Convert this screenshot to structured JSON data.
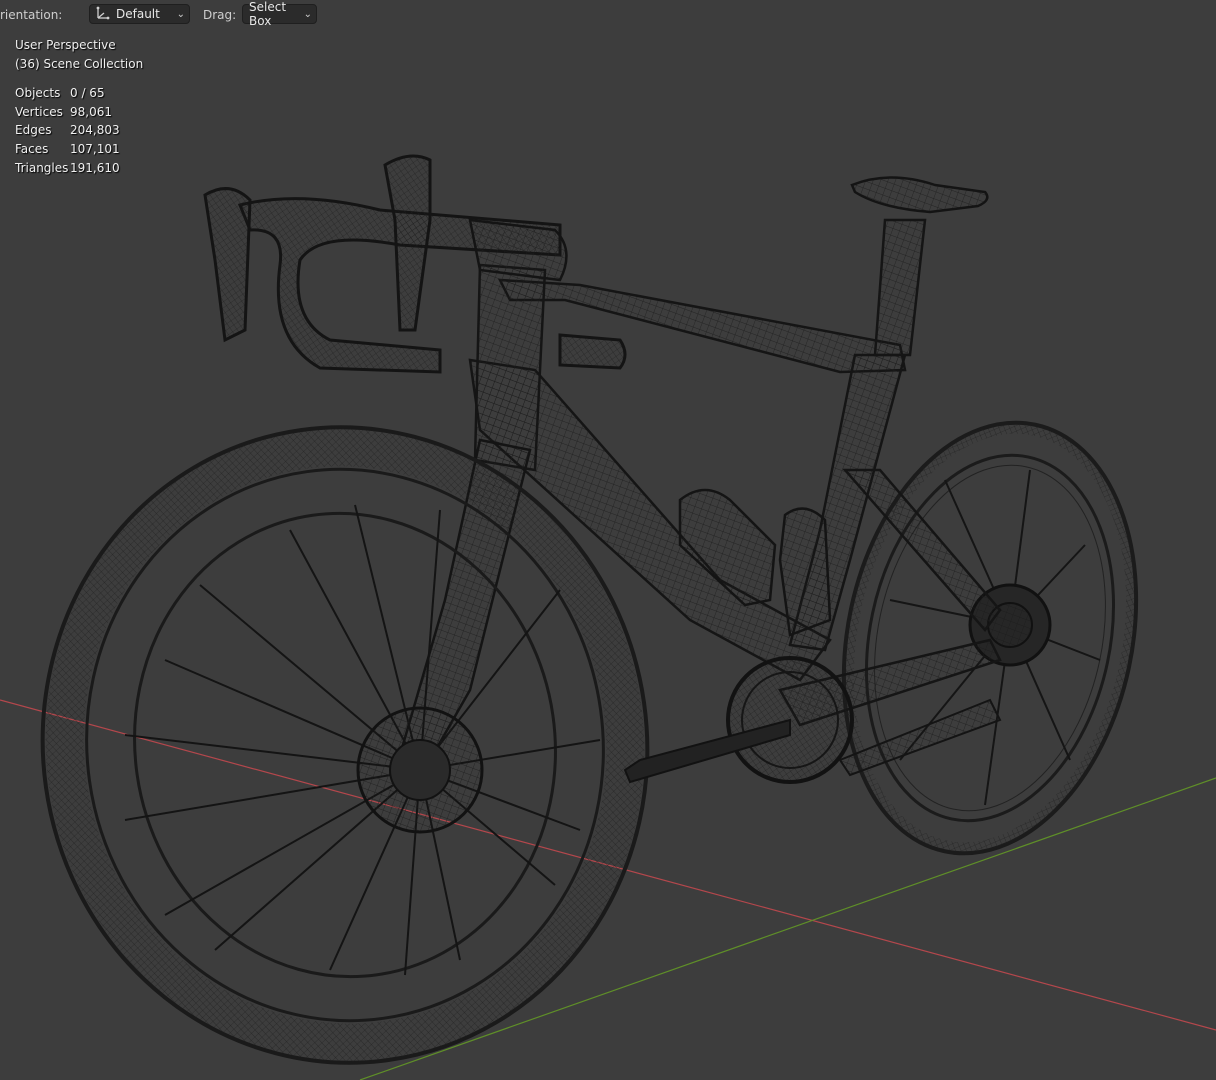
{
  "toolbar": {
    "orientation_label": "rientation:",
    "orientation_value": "Default",
    "drag_label": "Drag:",
    "drag_value": "Select Box"
  },
  "viewport": {
    "view_name": "User Perspective",
    "collection": "(36) Scene Collection",
    "stats": [
      {
        "label": "Objects",
        "value": "0 / 65"
      },
      {
        "label": "Vertices",
        "value": "98,061"
      },
      {
        "label": "Edges",
        "value": "204,803"
      },
      {
        "label": "Faces",
        "value": "107,101"
      },
      {
        "label": "Triangles",
        "value": "191,610"
      }
    ]
  },
  "colors": {
    "background": "#3d3d3d",
    "x_axis": "#c0484e",
    "y_axis": "#6b9b2a",
    "wire": "#1a1a1a"
  },
  "icons": [
    "orientation-gizmo-icon",
    "chevron-down-icon"
  ]
}
